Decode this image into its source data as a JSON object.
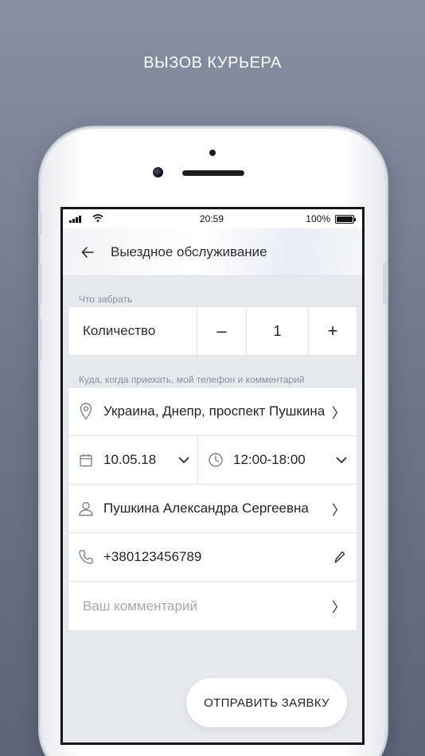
{
  "promo": {
    "title": "ВЫЗОВ КУРЬЕРА"
  },
  "status_bar": {
    "time": "20:59",
    "battery": "100%"
  },
  "header": {
    "back_icon": "arrow-left-icon",
    "title": "Выездное обслуживание"
  },
  "pickup": {
    "label": "Что забрать",
    "quantity_label": "Количество",
    "minus": "–",
    "value": "1",
    "plus": "+"
  },
  "delivery": {
    "label": "Куда, когда приехать, мой телефон и комментарий",
    "address": "Украина, Днепр, проспект Пушкина",
    "date": "10.05.18",
    "time": "12:00-18:00",
    "name": "Пушкина Александра Сергеевна",
    "phone": "+380123456789",
    "comment_placeholder": "Ваш комментарий",
    "chevron": "〉"
  },
  "submit": {
    "label": "ОТПРАВИТЬ ЗАЯВКУ"
  },
  "colors": {
    "screen_bg": "#e6e9ee",
    "card_bg": "#ffffff",
    "placeholder": "#a4a8b0"
  }
}
